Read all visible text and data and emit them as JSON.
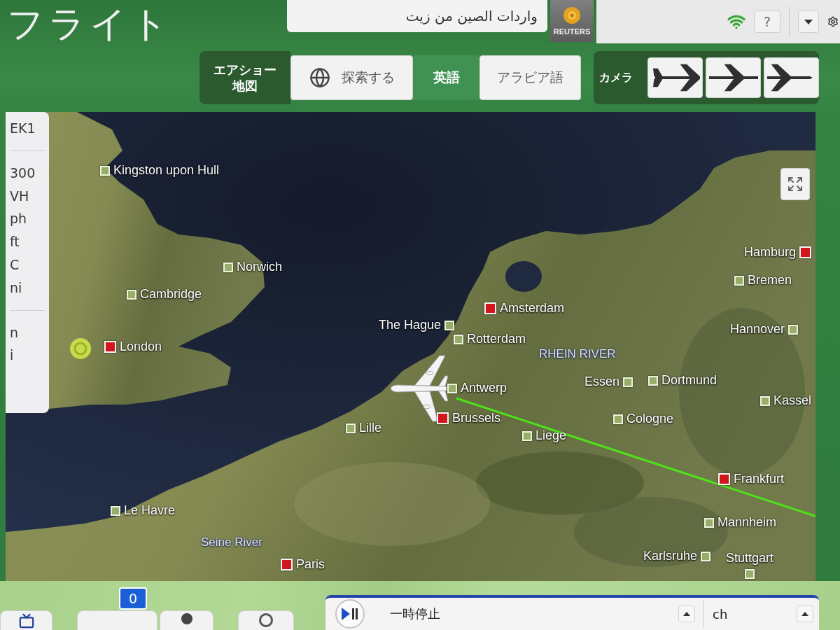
{
  "header": {
    "title": "フライト",
    "ticker": {
      "text": "واردات الصين من زيت",
      "source": "REUTERS"
    },
    "help_button": "?"
  },
  "toolbar": {
    "map_label": "エアショー地図",
    "tabs": [
      {
        "label": "探索する",
        "kind": "with_icon",
        "selected": false
      },
      {
        "label": "英語",
        "kind": "plain",
        "selected": true
      },
      {
        "label": "アラビア語",
        "kind": "plain",
        "selected": false
      }
    ]
  },
  "camera": {
    "label": "カメラ",
    "views": [
      {
        "kind": "rear"
      },
      {
        "kind": "middle"
      },
      {
        "kind": "front"
      }
    ]
  },
  "sidebar": {
    "groups": [
      [
        "EK1"
      ],
      [
        "300",
        "VH",
        "ph",
        "ft",
        "C",
        "ni"
      ],
      [
        "n",
        "i"
      ]
    ]
  },
  "map": {
    "cities": [
      {
        "name": "Kingston upon Hull",
        "kind": "minor"
      },
      {
        "name": "Norwich",
        "kind": "minor"
      },
      {
        "name": "Cambridge",
        "kind": "minor"
      },
      {
        "name": "London",
        "kind": "major"
      },
      {
        "name": "The Hague",
        "kind": "minor"
      },
      {
        "name": "Amsterdam",
        "kind": "major"
      },
      {
        "name": "Rotterdam",
        "kind": "minor"
      },
      {
        "name": "Antwerp",
        "kind": "minor"
      },
      {
        "name": "Brussels",
        "kind": "major"
      },
      {
        "name": "Lille",
        "kind": "minor"
      },
      {
        "name": "Liege",
        "kind": "minor"
      },
      {
        "name": "Essen",
        "kind": "minor"
      },
      {
        "name": "Dortmund",
        "kind": "minor"
      },
      {
        "name": "Cologne",
        "kind": "minor"
      },
      {
        "name": "Hamburg",
        "kind": "major"
      },
      {
        "name": "Bremen",
        "kind": "minor"
      },
      {
        "name": "Hannover",
        "kind": "minor"
      },
      {
        "name": "Kassel",
        "kind": "minor"
      },
      {
        "name": "Frankfurt",
        "kind": "major"
      },
      {
        "name": "Mannheim",
        "kind": "minor"
      },
      {
        "name": "Karlsruhe",
        "kind": "minor"
      },
      {
        "name": "Stuttgart",
        "kind": "minor"
      },
      {
        "name": "Le Havre",
        "kind": "minor"
      },
      {
        "name": "Paris",
        "kind": "major"
      }
    ],
    "rivers": [
      "RHEIN RIVER",
      "Seine River"
    ]
  },
  "footer": {
    "buttons": [
      {
        "kind": "tv"
      },
      {
        "kind": "counter",
        "badge": "0"
      },
      {
        "kind": "dot"
      },
      {
        "kind": "ring"
      }
    ],
    "player": {
      "status": "一時停止",
      "channel_label": "ch"
    }
  }
}
